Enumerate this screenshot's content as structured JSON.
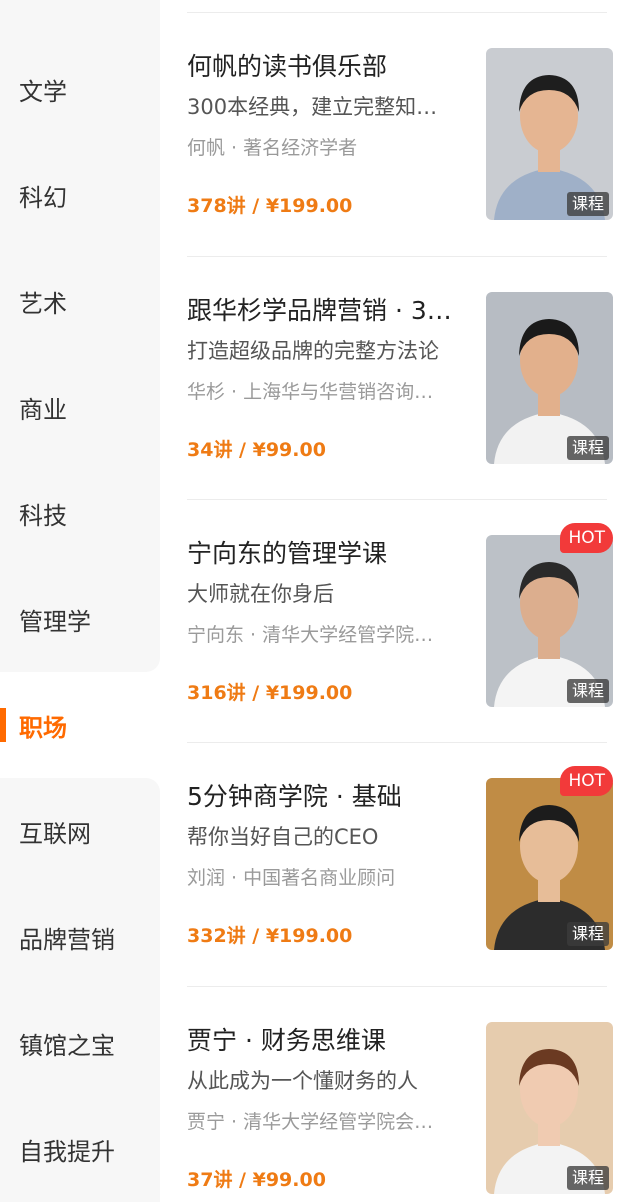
{
  "sidebar": {
    "items": [
      {
        "label": "文学"
      },
      {
        "label": "科幻"
      },
      {
        "label": "艺术"
      },
      {
        "label": "商业"
      },
      {
        "label": "科技"
      },
      {
        "label": "管理学"
      },
      {
        "label": "职场",
        "active": true
      },
      {
        "label": "互联网"
      },
      {
        "label": "品牌营销"
      },
      {
        "label": "镇馆之宝"
      },
      {
        "label": "自我提升"
      }
    ]
  },
  "courses": [
    {
      "title": "何帆的读书俱乐部",
      "subtitle": "300本经典，建立完整知…",
      "author": "何帆 · 著名经济学者",
      "price": "378讲 / ¥199.00",
      "tag": "课程",
      "hot": null,
      "colors": {
        "bg": "#c9ccd1",
        "shirt": "#9fb0c8",
        "skin": "#e5b592",
        "hair": "#1e1e1e"
      }
    },
    {
      "title": "跟华杉学品牌营销 · 3…",
      "subtitle": "打造超级品牌的完整方法论",
      "author": "华杉 · 上海华与华营销咨询…",
      "price": "34讲 / ¥99.00",
      "tag": "课程",
      "hot": null,
      "colors": {
        "bg": "#b7bcc3",
        "shirt": "#f2f2f2",
        "skin": "#e2b08c",
        "hair": "#1a1a1a"
      }
    },
    {
      "title": "宁向东的管理学课",
      "subtitle": "大师就在你身后",
      "author": "宁向东 · 清华大学经管学院…",
      "price": "316讲 / ¥199.00",
      "tag": "课程",
      "hot": "HOT",
      "colors": {
        "bg": "#bcc1c7",
        "shirt": "#f4f4f4",
        "skin": "#dcae8e",
        "hair": "#2a2a2a"
      }
    },
    {
      "title": "5分钟商学院 · 基础",
      "subtitle": "帮你当好自己的CEO",
      "author": "刘润 · 中国著名商业顾问",
      "price": "332讲 / ¥199.00",
      "tag": "课程",
      "hot": "HOT",
      "colors": {
        "bg": "#c08c45",
        "shirt": "#2c2c2c",
        "skin": "#e7bd98",
        "hair": "#1c1c1c"
      }
    },
    {
      "title": "贾宁 · 财务思维课",
      "subtitle": "从此成为一个懂财务的人",
      "author": "贾宁 · 清华大学经管学院会…",
      "price": "37讲 / ¥99.00",
      "tag": "课程",
      "hot": null,
      "colors": {
        "bg": "#e6ccae",
        "shirt": "#f3f3f3",
        "skin": "#f0cbb1",
        "hair": "#6b3a22"
      }
    }
  ]
}
